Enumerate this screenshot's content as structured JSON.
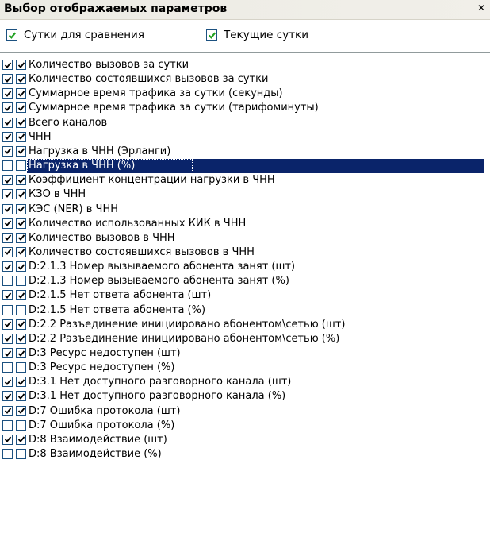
{
  "window": {
    "title": "Выбор отображаемых параметров",
    "close_glyph": "✕"
  },
  "top_options": [
    {
      "label": "Сутки для сравнения",
      "checked": true
    },
    {
      "label": "Текущие сутки",
      "checked": true
    }
  ],
  "rows": [
    {
      "label": "Количество вызовов за сутки",
      "c1": true,
      "c2": true
    },
    {
      "label": "Количество состоявшихся вызовов за сутки",
      "c1": true,
      "c2": true
    },
    {
      "label": "Суммарное время трафика за сутки (секунды)",
      "c1": true,
      "c2": true
    },
    {
      "label": "Суммарное время трафика за сутки (тарифоминуты)",
      "c1": true,
      "c2": true
    },
    {
      "label": "Всего каналов",
      "c1": true,
      "c2": true
    },
    {
      "label": "ЧНН",
      "c1": true,
      "c2": true
    },
    {
      "label": "Нагрузка в ЧНН (Эрланги)",
      "c1": true,
      "c2": true
    },
    {
      "label": "Нагрузка в ЧНН (%)",
      "c1": false,
      "c2": false,
      "selected": true
    },
    {
      "label": "Коэффициент концентрации нагрузки в ЧНН",
      "c1": true,
      "c2": true
    },
    {
      "label": "КЗО в ЧНН",
      "c1": true,
      "c2": true
    },
    {
      "label": "КЭС (NER) в ЧНН",
      "c1": true,
      "c2": true
    },
    {
      "label": "Количество использованных КИК в ЧНН",
      "c1": true,
      "c2": true
    },
    {
      "label": "Количество вызовов в ЧНН",
      "c1": true,
      "c2": true
    },
    {
      "label": "Количество состоявшихся вызовов в ЧНН",
      "c1": true,
      "c2": true
    },
    {
      "label": "D:2.1.3 Номер вызываемого абонента занят (шт)",
      "c1": true,
      "c2": true
    },
    {
      "label": "D:2.1.3 Номер вызываемого абонента занят (%)",
      "c1": false,
      "c2": false
    },
    {
      "label": "D:2.1.5 Нет ответа абонента (шт)",
      "c1": true,
      "c2": true
    },
    {
      "label": "D:2.1.5 Нет ответа абонента (%)",
      "c1": false,
      "c2": false
    },
    {
      "label": "D:2.2 Разъединение инициировано абонентом\\сетью (шт)",
      "c1": true,
      "c2": true
    },
    {
      "label": "D:2.2 Разъединение инициировано абонентом\\сетью (%)",
      "c1": true,
      "c2": true
    },
    {
      "label": "D:3 Ресурс недоступен (шт)",
      "c1": true,
      "c2": true
    },
    {
      "label": "D:3 Ресурс недоступен (%)",
      "c1": false,
      "c2": false
    },
    {
      "label": "D:3.1 Нет доступного разговорного канала (шт)",
      "c1": true,
      "c2": true
    },
    {
      "label": "D:3.1 Нет доступного разговорного канала (%)",
      "c1": true,
      "c2": true
    },
    {
      "label": "D:7 Ошибка протокола (шт)",
      "c1": true,
      "c2": true
    },
    {
      "label": "D:7 Ошибка протокола (%)",
      "c1": false,
      "c2": false
    },
    {
      "label": "D:8 Взаимодействие (шт)",
      "c1": true,
      "c2": true
    },
    {
      "label": "D:8 Взаимодействие (%)",
      "c1": false,
      "c2": false
    }
  ]
}
